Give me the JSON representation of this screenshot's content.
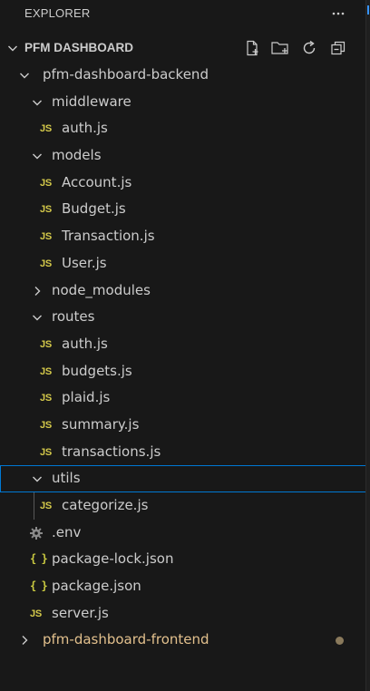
{
  "pane": {
    "title": "EXPLORER",
    "more_icon": "ellipsis-icon"
  },
  "section": {
    "title": "PFM DASHBOARD",
    "actions": [
      "new-file-icon",
      "new-folder-icon",
      "refresh-icon",
      "collapse-all-icon"
    ]
  },
  "tree": {
    "backend_folder": "pfm-dashboard-backend",
    "middleware_folder": "middleware",
    "middleware_auth": "auth.js",
    "models_folder": "models",
    "models_account": "Account.js",
    "models_budget": "Budget.js",
    "models_transaction": "Transaction.js",
    "models_user": "User.js",
    "node_modules_folder": "node_modules",
    "routes_folder": "routes",
    "routes_auth": "auth.js",
    "routes_budgets": "budgets.js",
    "routes_plaid": "plaid.js",
    "routes_summary": "summary.js",
    "routes_transactions": "transactions.js",
    "utils_folder": "utils",
    "utils_categorize": "categorize.js",
    "env_file": ".env",
    "package_lock": "package-lock.json",
    "package_json": "package.json",
    "server_js": "server.js",
    "frontend_folder": "pfm-dashboard-frontend"
  },
  "badges": {
    "js": "JS",
    "json": "{ }"
  },
  "colors": {
    "background": "#181818",
    "text": "#cccccc",
    "js_badge": "#d4c94a",
    "json_badge": "#cbcb41",
    "modified": "#e2c08d",
    "selection_border": "#0078d4"
  }
}
